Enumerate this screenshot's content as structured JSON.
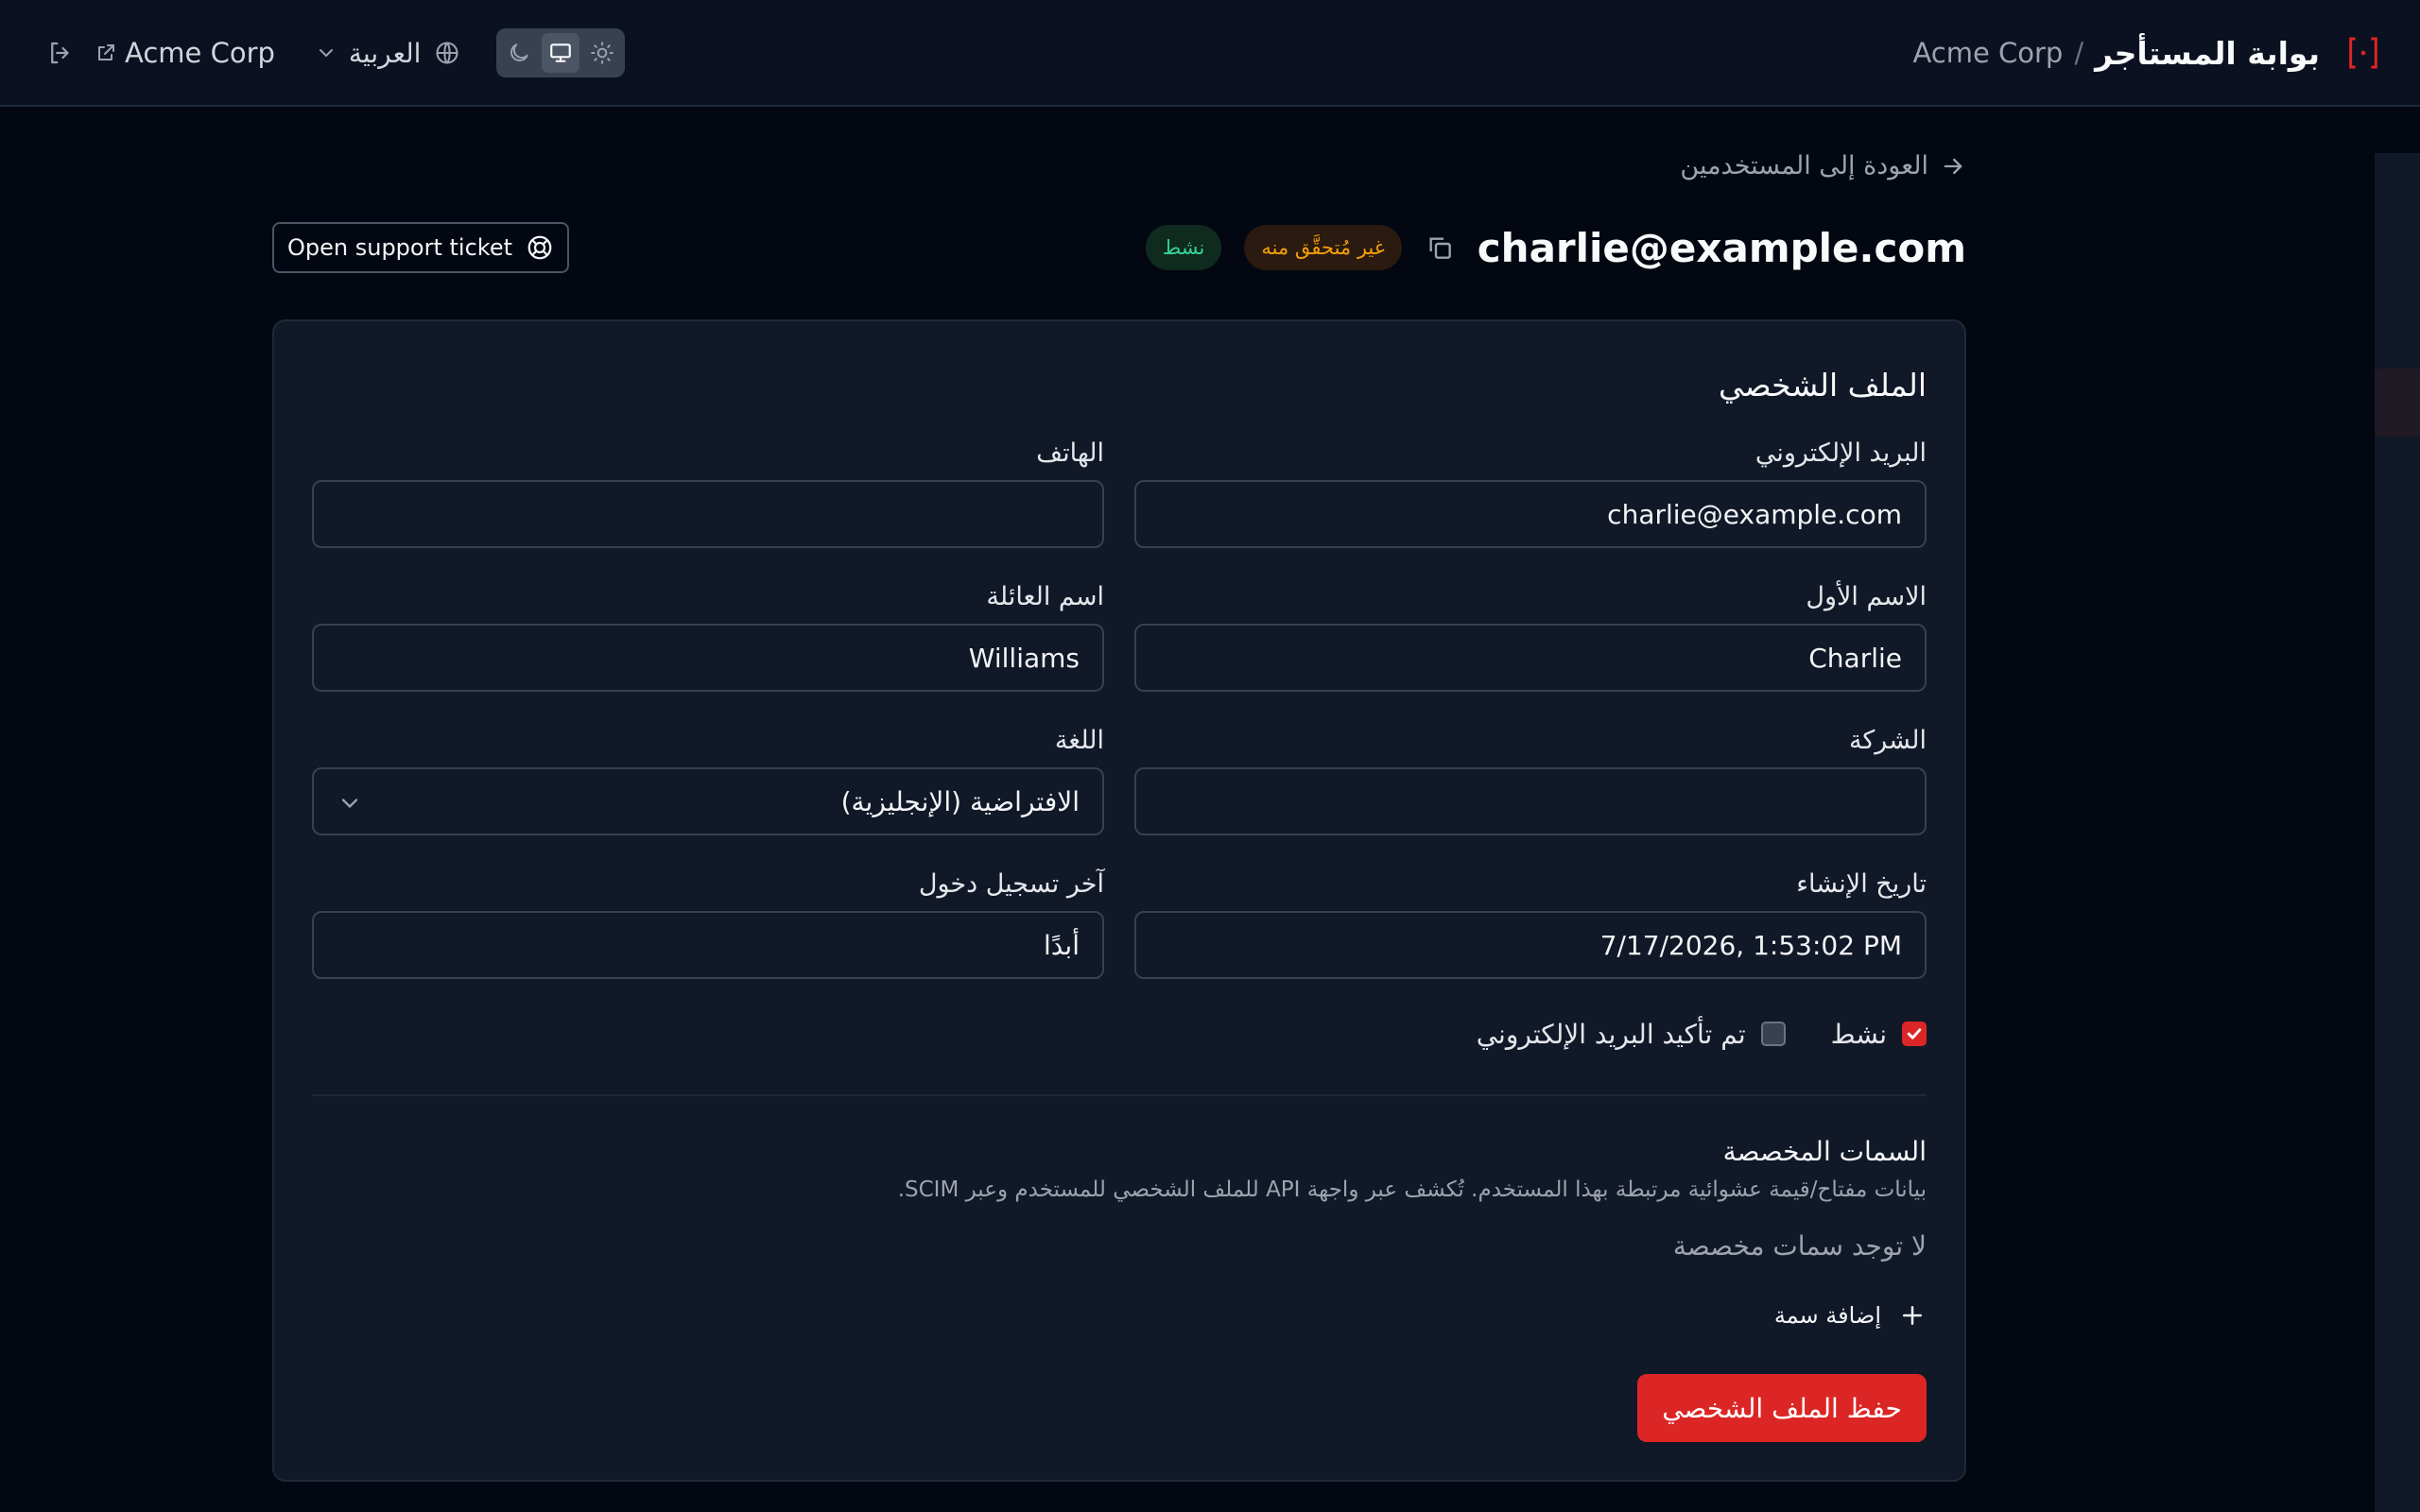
{
  "header": {
    "portal_title": "بوابة المستأجر",
    "breadcrumb_separator": "/",
    "org_name": "Acme Corp",
    "org_link_label": "Acme Corp",
    "language_label": "العربية",
    "theme_options": [
      "dark",
      "system",
      "light"
    ],
    "active_theme": "system",
    "brand_color": "#dc2626"
  },
  "page": {
    "back_link": "العودة إلى المستخدمين",
    "user_email": "charlie@example.com",
    "badge_unverified": "غير مُتحقَّق منه",
    "badge_active": "نشط",
    "support_button": "Open support ticket"
  },
  "profile": {
    "title": "الملف الشخصي",
    "email_label": "البريد الإلكتروني",
    "email_value": "charlie@example.com",
    "phone_label": "الهاتف",
    "phone_value": "",
    "first_name_label": "الاسم الأول",
    "first_name_value": "Charlie",
    "last_name_label": "اسم العائلة",
    "last_name_value": "Williams",
    "company_label": "الشركة",
    "company_value": "",
    "language_label": "اللغة",
    "language_value": "الافتراضية (الإنجليزية)",
    "created_label": "تاريخ الإنشاء",
    "created_value": "7/17/2026, 1:53:02 PM",
    "last_login_label": "آخر تسجيل دخول",
    "last_login_value": "أبدًا",
    "active_label": "نشط",
    "active_checked": true,
    "email_verified_label": "تم تأكيد البريد الإلكتروني",
    "email_verified_checked": false
  },
  "attributes": {
    "title": "السمات المخصصة",
    "description": "بيانات مفتاح/قيمة عشوائية مرتبطة بهذا المستخدم. تُكشف عبر واجهة API للملف الشخصي للمستخدم وعبر SCIM.",
    "empty_text": "لا توجد سمات مخصصة",
    "add_button": "إضافة سمة"
  },
  "actions": {
    "save_button": "حفظ الملف الشخصي"
  }
}
